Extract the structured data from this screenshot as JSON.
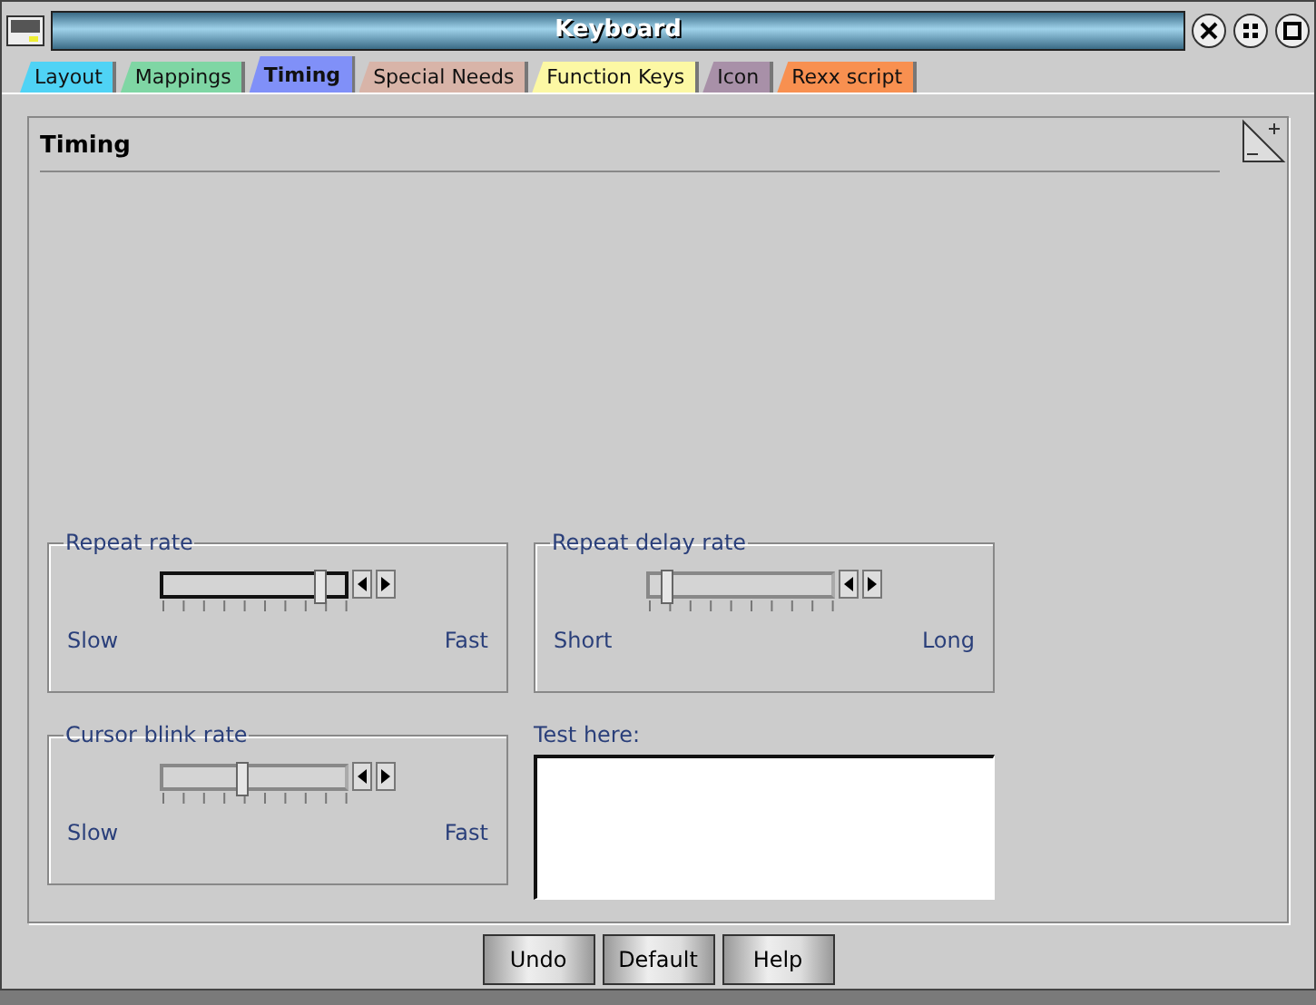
{
  "window": {
    "title": "Keyboard"
  },
  "tabs": [
    {
      "label": "Layout",
      "selected": false,
      "color": "#4fd3f5"
    },
    {
      "label": "Mappings",
      "selected": false,
      "color": "#7fd6a4"
    },
    {
      "label": "Timing",
      "selected": true,
      "color": "#8090f8"
    },
    {
      "label": "Special Needs",
      "selected": false,
      "color": "#d8b4a8"
    },
    {
      "label": "Function Keys",
      "selected": false,
      "color": "#fcf8a4"
    },
    {
      "label": "Icon",
      "selected": false,
      "color": "#a890a8"
    },
    {
      "label": "Rexx script",
      "selected": false,
      "color": "#f89050"
    }
  ],
  "page": {
    "heading": "Timing"
  },
  "sliders": [
    {
      "title": "Repeat rate",
      "level": 0.87,
      "focused": true,
      "min_label": "Slow",
      "max_label": "Fast"
    },
    {
      "title": "Repeat delay rate",
      "level": 0.1,
      "focused": false,
      "min_label": "Short",
      "max_label": "Long"
    },
    {
      "title": "Cursor blink rate",
      "level": 0.44,
      "focused": false,
      "min_label": "Slow",
      "max_label": "Fast"
    }
  ],
  "test_field": {
    "label": "Test here:"
  },
  "buttons": [
    "Undo",
    "Default",
    "Help"
  ]
}
